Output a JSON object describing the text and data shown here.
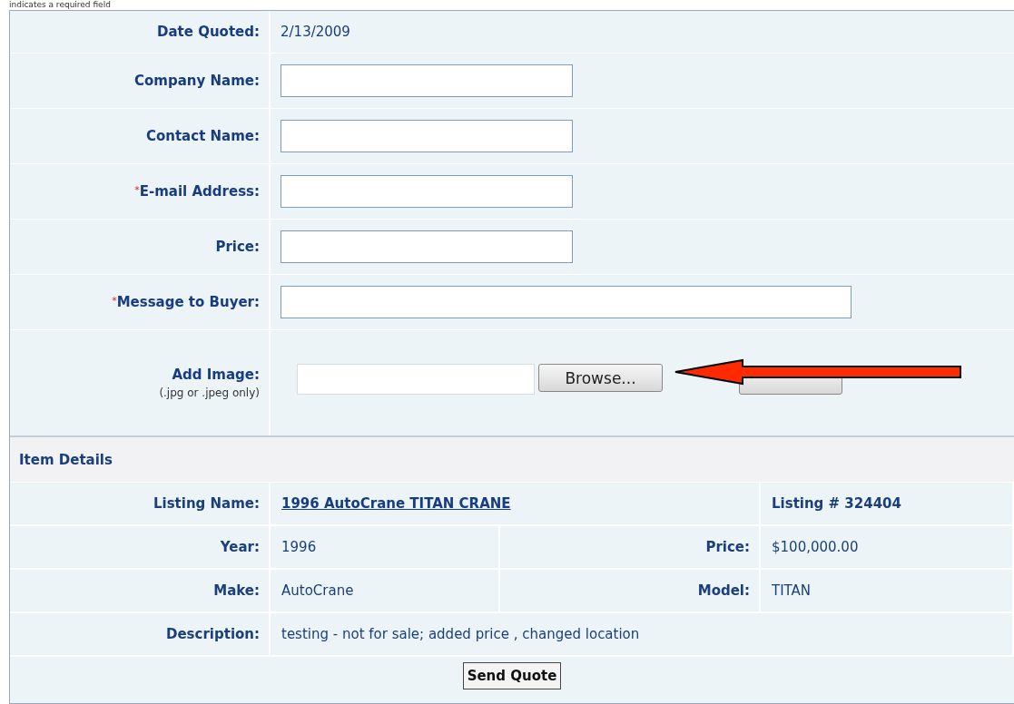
{
  "note": "indicates a required field",
  "required_mark": "*",
  "form": {
    "rows": [
      {
        "kind": "static",
        "label": "Date Quoted:",
        "required": false,
        "value": "2/13/2009"
      },
      {
        "kind": "text",
        "label": "Company Name:",
        "required": false
      },
      {
        "kind": "text",
        "label": "Contact Name:",
        "required": false
      },
      {
        "kind": "text",
        "label": "E-mail Address:",
        "required": true
      },
      {
        "kind": "text",
        "label": "Price:",
        "required": false
      },
      {
        "kind": "message",
        "label": "Message to Buyer:",
        "required": true
      },
      {
        "kind": "file",
        "label": "Add Image:",
        "hint": "(.jpg or .jpeg only)",
        "required": false,
        "button": "Browse..."
      }
    ]
  },
  "item_details": {
    "title": "Item Details",
    "listing_label": "Listing Name:",
    "listing_link": "1996 AutoCrane TITAN CRANE",
    "listing_number": "Listing # 324404",
    "pairs": [
      [
        {
          "label": "Year:",
          "value": "1996"
        },
        {
          "label": "Price:",
          "value": "$100,000.00"
        }
      ],
      [
        {
          "label": "Make:",
          "value": "AutoCrane"
        },
        {
          "label": "Model:",
          "value": "TITAN"
        }
      ]
    ],
    "description_label": "Description:",
    "description": "testing - not for sale; added price , changed location"
  },
  "submit": "Send Quote"
}
